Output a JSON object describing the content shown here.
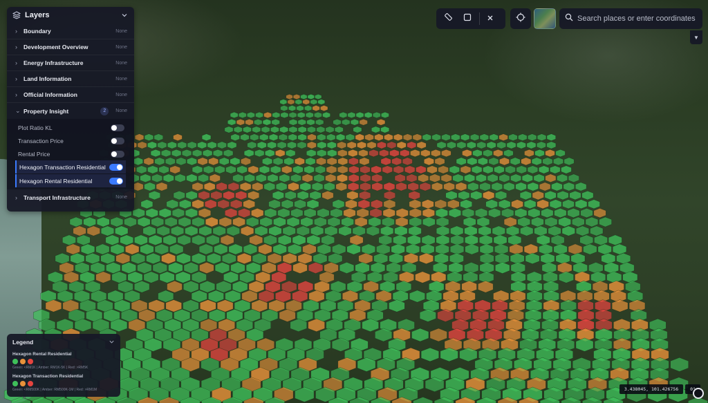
{
  "layers_panel": {
    "title": "Layers",
    "groups": [
      {
        "label": "Boundary",
        "status": "None"
      },
      {
        "label": "Development Overview",
        "status": "None"
      },
      {
        "label": "Energy Infrastructure",
        "status": "None"
      },
      {
        "label": "Land Information",
        "status": "None"
      },
      {
        "label": "Official Information",
        "status": "None"
      },
      {
        "label": "Property Insight",
        "status": "None",
        "count": "2",
        "expanded": true,
        "sublayers": [
          {
            "label": "Plot Ratio KL",
            "enabled": false
          },
          {
            "label": "Transaction Price",
            "enabled": false
          },
          {
            "label": "Rental Price",
            "enabled": false
          },
          {
            "label": "Hexagon Transaction Residential",
            "enabled": true
          },
          {
            "label": "Hexagon Rental Residential",
            "enabled": true
          }
        ]
      },
      {
        "label": "Transport Infrastructure",
        "status": "None"
      }
    ]
  },
  "search": {
    "placeholder": "Search places or enter coordinates"
  },
  "legend": {
    "title": "Legend",
    "items": [
      {
        "name": "Hexagon Rental Residential",
        "description": "Green: <RM1K | Amber: RM1K-5K | Red: >RM5K"
      },
      {
        "name": "Hexagon Transaction Residential",
        "description": "Green: <RM500K | Amber: RM500K-1M | Red: >RM1M"
      }
    ],
    "colors": {
      "green": "#3fbf5a",
      "amber": "#e8913a",
      "red": "#e5443f"
    }
  },
  "coordinates": "3.438045, 101.426756",
  "heading": "0°",
  "icons": [
    "layers-icon",
    "ruler-icon",
    "square-draw-icon",
    "close-icon",
    "crosshair-icon",
    "search-icon",
    "chevron-down-icon",
    "chevron-right-icon",
    "compass-icon"
  ]
}
